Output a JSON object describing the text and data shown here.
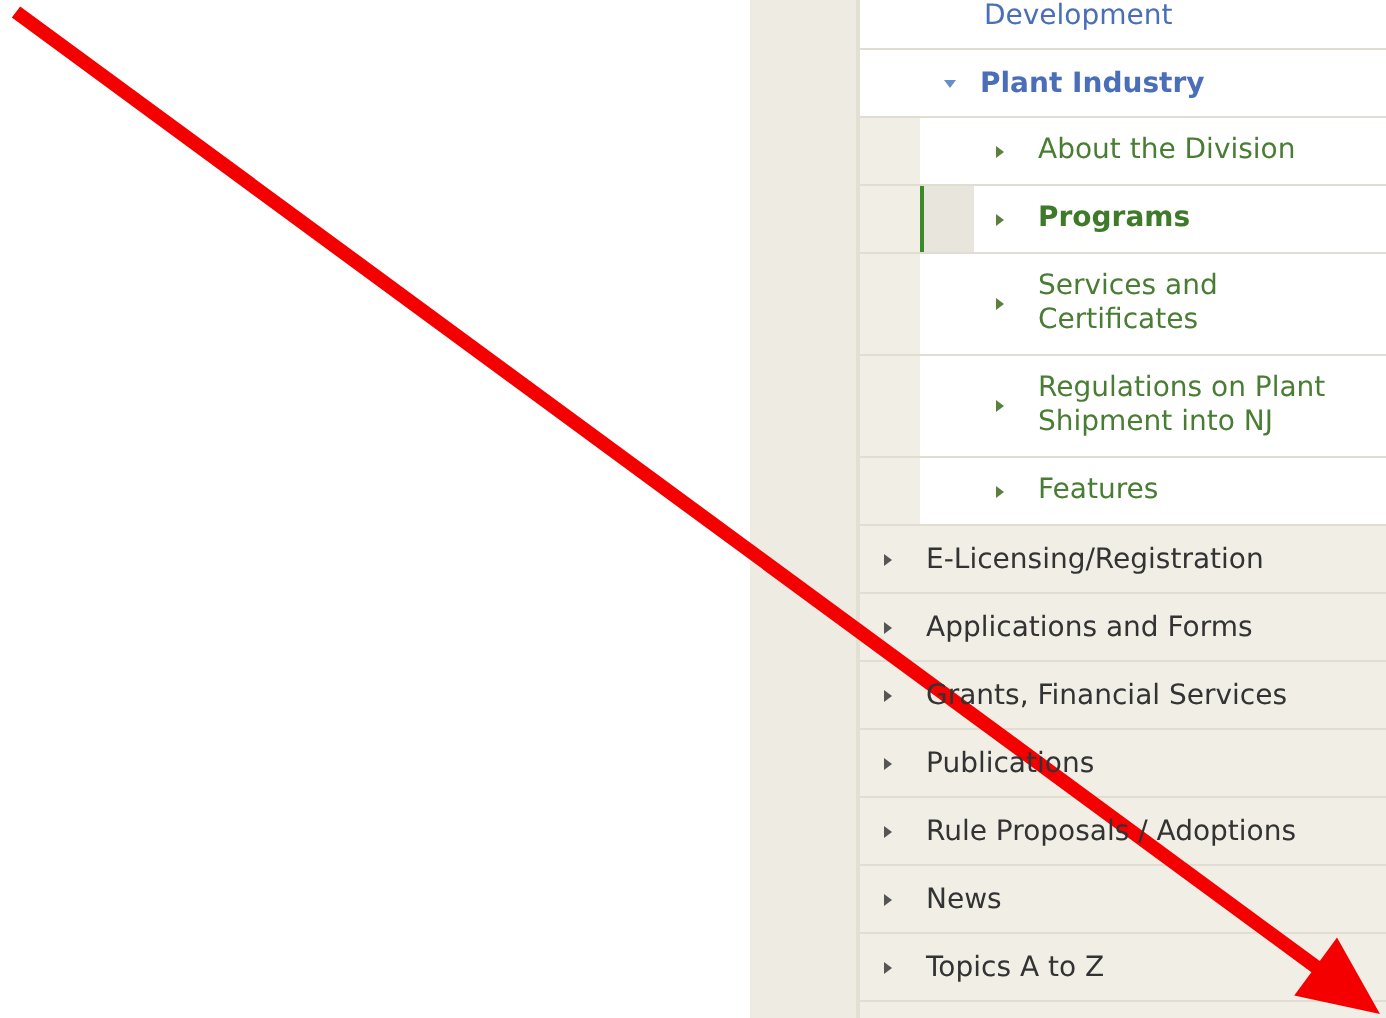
{
  "menu": {
    "section_items": [
      {
        "label": "Development"
      },
      {
        "label": "Plant Industry",
        "expanded": true,
        "children": [
          {
            "label": "About the Division",
            "selected": false
          },
          {
            "label": "Programs",
            "selected": true
          },
          {
            "label": "Services and Certificates",
            "selected": false
          },
          {
            "label": "Regulations on Plant Shipment into NJ",
            "selected": false
          },
          {
            "label": "Features",
            "selected": false
          }
        ]
      }
    ],
    "items": [
      {
        "label": "E-Licensing/Registration"
      },
      {
        "label": "Applications and Forms"
      },
      {
        "label": "Grants, Financial Services"
      },
      {
        "label": "Publications"
      },
      {
        "label": "Rule Proposals / Adoptions"
      },
      {
        "label": "News"
      },
      {
        "label": "Topics A to Z"
      }
    ]
  }
}
